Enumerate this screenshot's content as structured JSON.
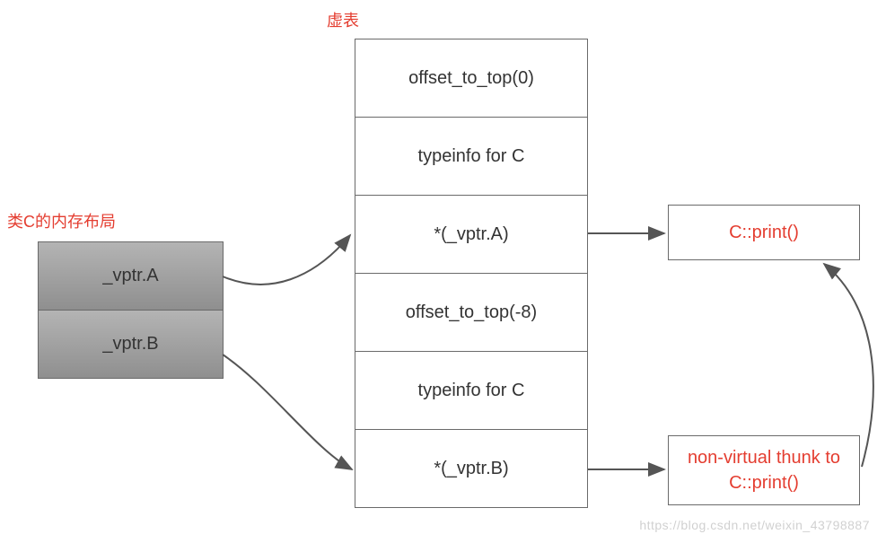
{
  "labels": {
    "mem_title": "类C的内存布局",
    "vtable_title": "虚表"
  },
  "mem": {
    "items": [
      "_vptr.A",
      "_vptr.B"
    ]
  },
  "vtable": {
    "items": [
      "offset_to_top(0)",
      "typeinfo for C",
      "*(_vptr.A)",
      "offset_to_top(-8)",
      "typeinfo for C",
      "*(_vptr.B)"
    ]
  },
  "right": {
    "box1": "C::print()",
    "box2": "non-virtual thunk to C::print()"
  },
  "colors": {
    "accent": "#e43d30",
    "border": "#6a6a6a"
  },
  "watermark": "https://blog.csdn.net/weixin_43798887"
}
